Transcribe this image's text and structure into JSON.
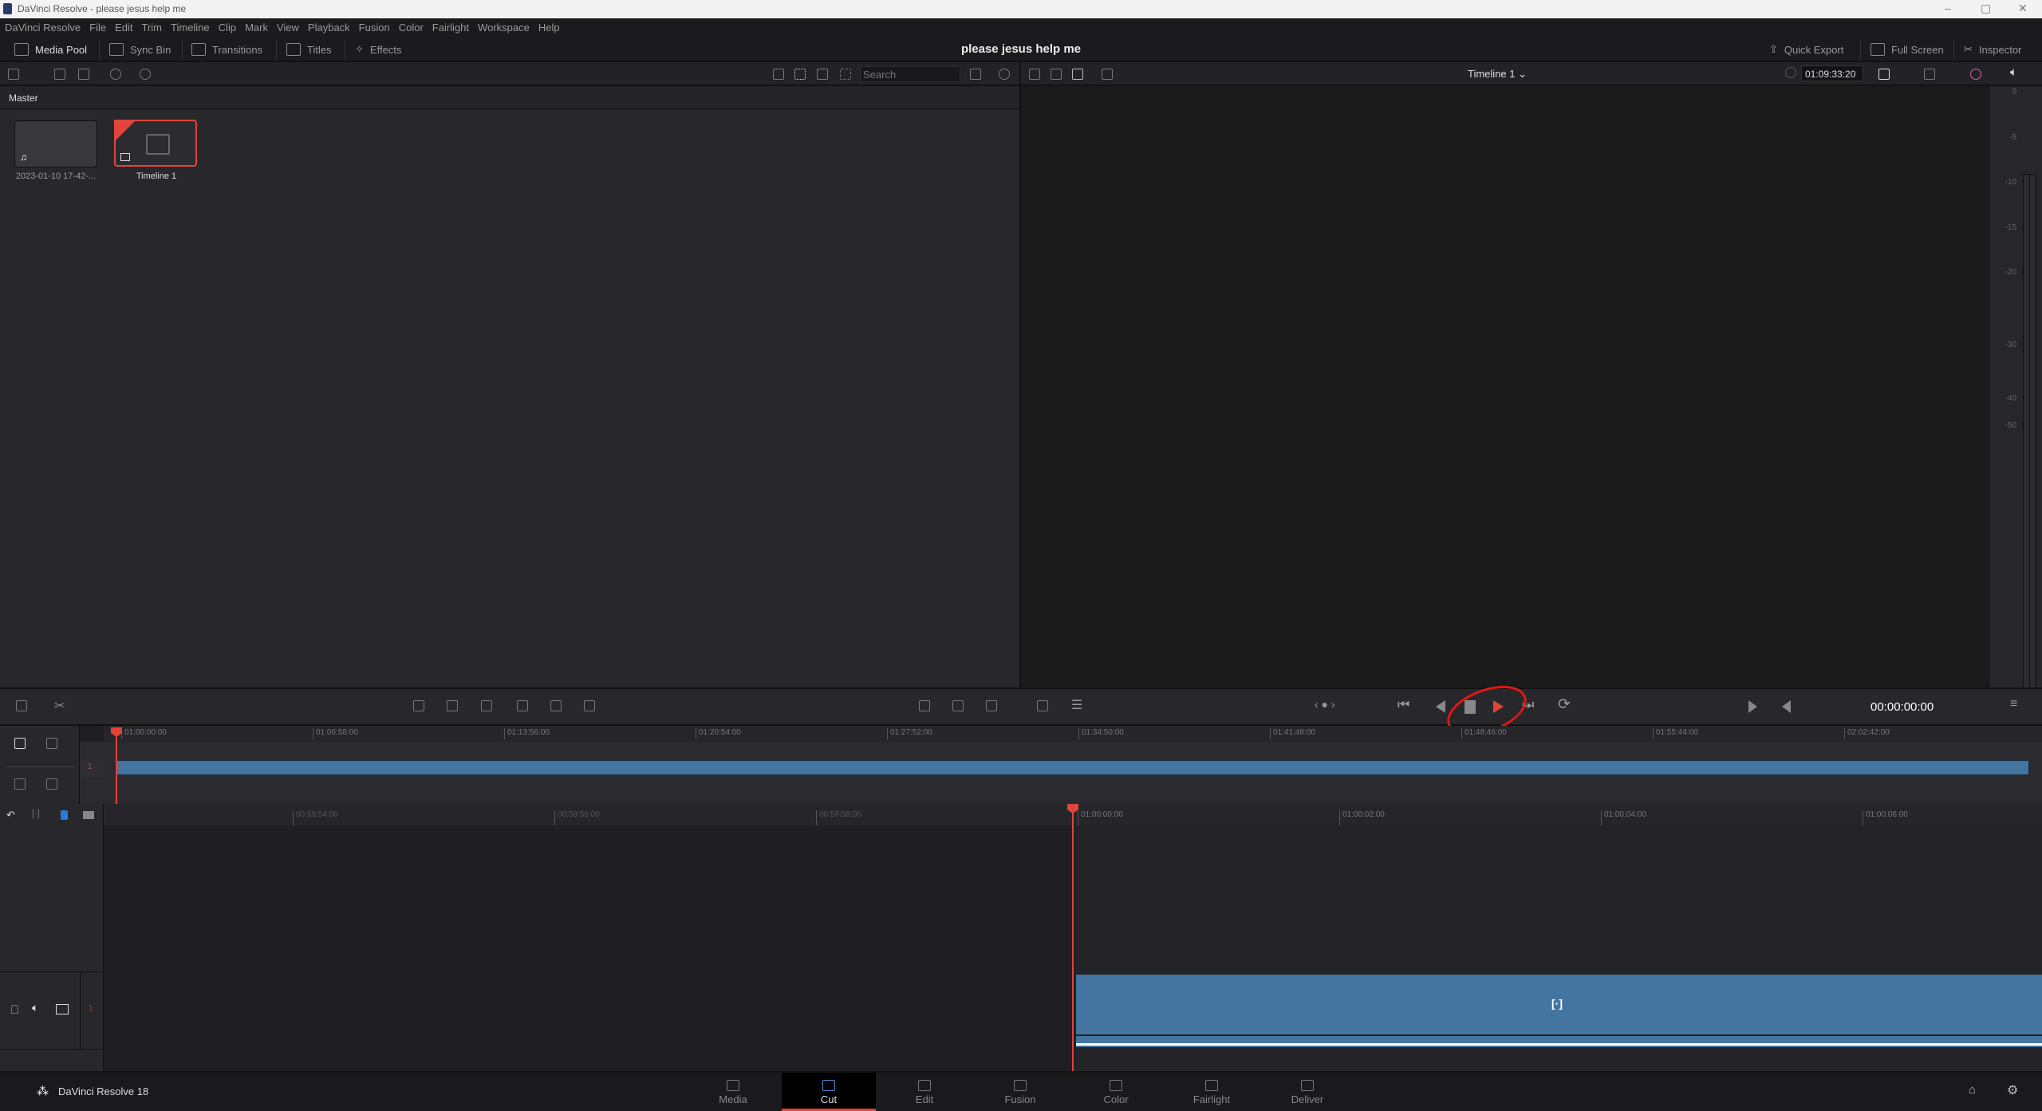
{
  "window": {
    "title": "DaVinci Resolve - please jesus help me",
    "minimize": "–",
    "maximize": "▢",
    "close": "✕"
  },
  "menu": [
    "DaVinci Resolve",
    "File",
    "Edit",
    "Trim",
    "Timeline",
    "Clip",
    "Mark",
    "View",
    "Playback",
    "Fusion",
    "Color",
    "Fairlight",
    "Workspace",
    "Help"
  ],
  "toolbar": {
    "media_pool": "Media Pool",
    "sync_bin": "Sync Bin",
    "transitions": "Transitions",
    "titles": "Titles",
    "effects": "Effects",
    "project_title": "please jesus help me",
    "quick_export": "Quick Export",
    "full_screen": "Full Screen",
    "inspector": "Inspector"
  },
  "media_pool": {
    "search_placeholder": "Search",
    "bin": "Master",
    "items": [
      {
        "label": "2023-01-10 17-42-...",
        "type": "audio"
      },
      {
        "label": "Timeline 1",
        "type": "timeline",
        "selected": true
      }
    ]
  },
  "viewer": {
    "timeline_name": "Timeline 1",
    "duration": "01:09:33:20",
    "timecode": "00:00:00:00"
  },
  "meter": {
    "labels": [
      "0",
      "-5",
      "-10",
      "-15",
      "-20",
      "-30",
      "-40",
      "-50"
    ]
  },
  "upper_ruler": [
    "01:00:00:00",
    "01:06:58:00",
    "01:13:56:00",
    "01:20:54:00",
    "01:27:52:00",
    "01:34:50:00",
    "01:41:48:00",
    "01:48:46:00",
    "01:55:44:00",
    "02:02:42:00"
  ],
  "lower_ruler": [
    "00:59:54:00",
    "00:59:56:00",
    "00:59:58:00",
    "01:00:00:00",
    "01:00:02:00",
    "01:00:04:00",
    "01:00:06:00"
  ],
  "tracks": {
    "video_index": "1",
    "audio_index": "1"
  },
  "accent": "#e0443a",
  "clip_color": "#4375a0",
  "footer": {
    "app": "DaVinci Resolve 18",
    "pages": [
      "Media",
      "Cut",
      "Edit",
      "Fusion",
      "Color",
      "Fairlight",
      "Deliver"
    ],
    "active_page": "Cut"
  }
}
